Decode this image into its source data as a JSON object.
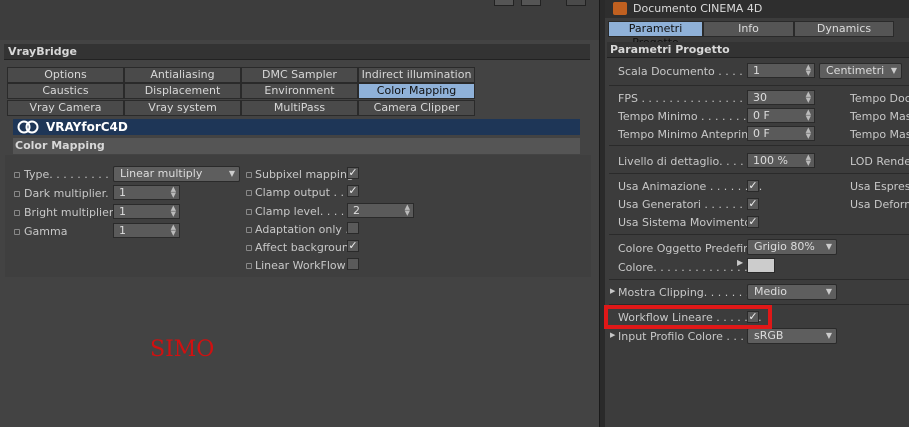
{
  "left": {
    "window_buttons": [
      "_",
      "□",
      "x"
    ],
    "vraybridge_title": "VrayBridge",
    "tabs": [
      {
        "label": "Options",
        "active": false
      },
      {
        "label": "Antialiasing",
        "active": false
      },
      {
        "label": "DMC Sampler",
        "active": false
      },
      {
        "label": "Indirect illumination (GI)",
        "active": false
      },
      {
        "label": "Caustics",
        "active": false
      },
      {
        "label": "Displacement",
        "active": false
      },
      {
        "label": "Environment",
        "active": false
      },
      {
        "label": "Color Mapping",
        "active": true
      },
      {
        "label": "Vray Camera",
        "active": false
      },
      {
        "label": "Vray system",
        "active": false
      },
      {
        "label": "MultiPass",
        "active": false
      },
      {
        "label": "Camera Clipper",
        "active": false
      }
    ],
    "logo_text": "VRAYforC4D",
    "section_title": "Color Mapping",
    "params": {
      "type_label": "Type. . . . . . . . . . .",
      "type_value": "Linear multiply",
      "dark_label": "Dark multiplier. . .",
      "dark_value": "1",
      "bright_label": "Bright multiplier . .",
      "bright_value": "1",
      "gamma_label": "Gamma",
      "gamma_value": "1",
      "subpixel_label": "Subpixel mapping",
      "subpixel_checked": true,
      "clamp_output_label": "Clamp output . . . .",
      "clamp_output_checked": true,
      "clamp_level_label": "Clamp level. . . . . .",
      "clamp_level_value": "2",
      "adaptation_label": "Adaptation only . .",
      "adaptation_checked": false,
      "affect_bg_label": "Affect background",
      "affect_bg_checked": true,
      "linear_wf_label": "Linear WorkFlow",
      "linear_wf_checked": false
    },
    "annotation": "SIMO",
    "annotation_color": "#d01010"
  },
  "right": {
    "title": "Documento CINEMA 4D",
    "tabs": [
      {
        "label": "Parametri Progetto",
        "active": true
      },
      {
        "label": "Info",
        "active": false
      },
      {
        "label": "Dynamics",
        "active": false
      }
    ],
    "section_title": "Parametri Progetto",
    "scala_label": "Scala Documento . . . . .",
    "scala_value": "1",
    "scala_unit": "Centimetri",
    "fps_label": "FPS . . . . . . . . . . . . . . . .",
    "fps_value": "30",
    "tempo_min_label": "Tempo Minimo . . . . . . . .",
    "tempo_min_value": "0 F",
    "tempo_min_ant_label": "Tempo Minimo Anteprima",
    "tempo_min_ant_value": "0 F",
    "tempo_doc_label": "Tempo Docu",
    "tempo_mass_label": "Tempo Mass",
    "tempo_mass2_label": "Tempo Mass",
    "livello_label": "Livello di dettaglio. . . . . .",
    "livello_value": "100 %",
    "lod_label": "LOD Render",
    "usa_anim_label": "Usa Animazione . . . . . . . .",
    "usa_anim_checked": true,
    "usa_gen_label": "Usa Generatori . . . . . . . .",
    "usa_gen_checked": true,
    "usa_sis_label": "Usa Sistema Movimento",
    "usa_sis_checked": true,
    "usa_espr_label": "Usa Espress",
    "usa_def_label": "Usa Deforma",
    "colore_ogg_label": "Colore Oggetto Predefinito",
    "colore_ogg_value": "Grigio 80%",
    "colore_label": "Colore. . . . . . . . . . . . . . .",
    "colore_swatch": "#cccccc",
    "mostra_label": "Mostra Clipping. . . . . . . .",
    "mostra_value": "Medio",
    "workflow_label": "Workflow Lineare . . . . . . .",
    "workflow_checked": true,
    "input_label": "Input Profilo Colore . . . . .",
    "input_value": "sRGB",
    "highlight_color": "#e01818"
  }
}
